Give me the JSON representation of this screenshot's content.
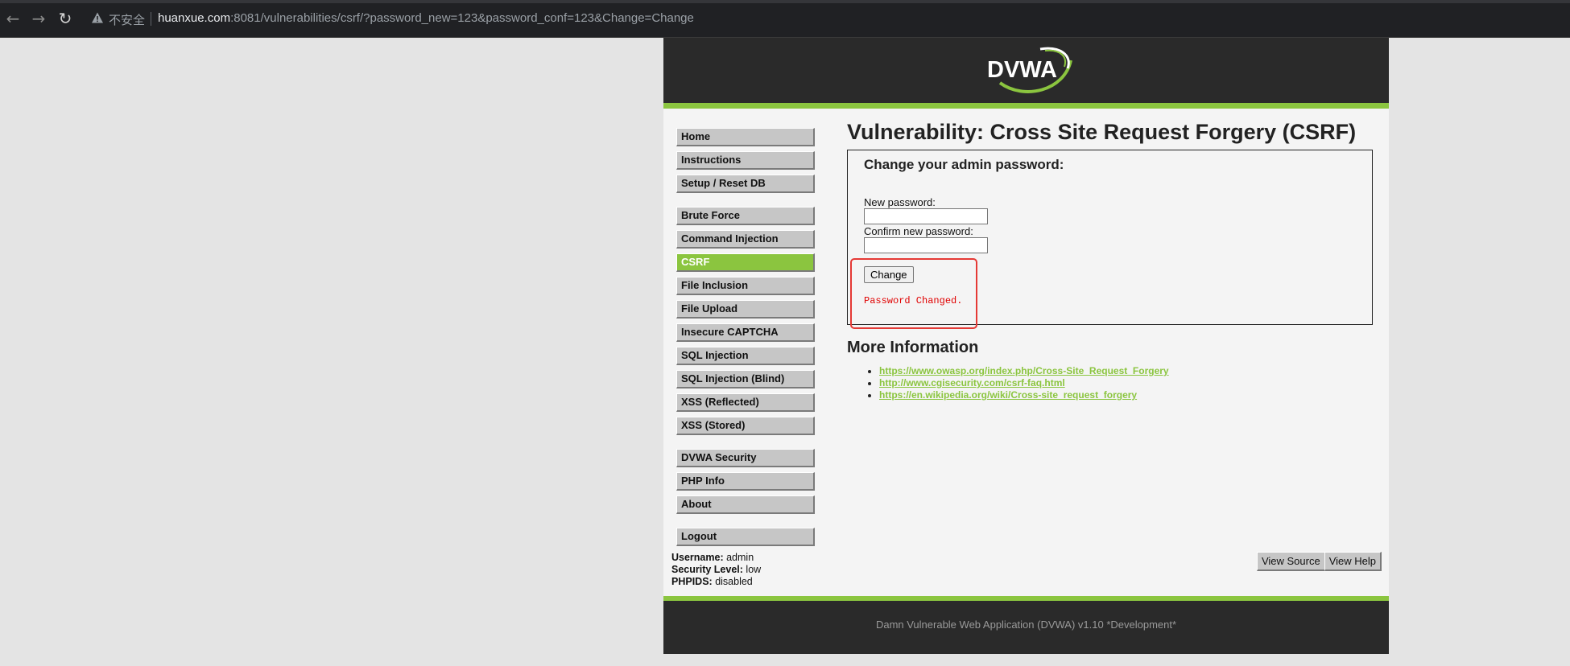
{
  "browser": {
    "not_secure_label": "不安全",
    "url_host": "huanxue.com",
    "url_rest": ":8081/vulnerabilities/csrf/?password_new=123&password_conf=123&Change=Change",
    "back_icon": "back-arrow-icon",
    "forward_icon": "forward-arrow-icon",
    "reload_icon": "reload-icon"
  },
  "header": {
    "logo_text": "DVWA"
  },
  "menu": {
    "group1": [
      "Home",
      "Instructions",
      "Setup / Reset DB"
    ],
    "group2": [
      "Brute Force",
      "Command Injection",
      "CSRF",
      "File Inclusion",
      "File Upload",
      "Insecure CAPTCHA",
      "SQL Injection",
      "SQL Injection (Blind)",
      "XSS (Reflected)",
      "XSS (Stored)"
    ],
    "group3": [
      "DVWA Security",
      "PHP Info",
      "About"
    ],
    "group4": [
      "Logout"
    ],
    "selected": "CSRF"
  },
  "main": {
    "title": "Vulnerability: Cross Site Request Forgery (CSRF)",
    "form_heading": "Change your admin password:",
    "new_password_label": "New password:",
    "confirm_password_label": "Confirm new password:",
    "new_password_value": "",
    "confirm_password_value": "",
    "change_button": "Change",
    "result_message": "Password Changed.",
    "more_info_title": "More Information",
    "links": [
      "https://www.owasp.org/index.php/Cross-Site_Request_Forgery",
      "http://www.cgisecurity.com/csrf-faq.html",
      "https://en.wikipedia.org/wiki/Cross-site_request_forgery"
    ]
  },
  "user_info": {
    "username_label": "Username:",
    "username": "admin",
    "security_label": "Security Level:",
    "security": "low",
    "phpids_label": "PHPIDS:",
    "phpids": "disabled"
  },
  "footer": {
    "view_source": "View Source",
    "view_help": "View Help",
    "text": "Damn Vulnerable Web Application (DVWA) v1.10 *Development*"
  },
  "colors": {
    "accent_green": "#8bc53f",
    "header_bg": "#2a2a2a",
    "message_red": "#e00000",
    "highlight_red": "#e53935"
  }
}
